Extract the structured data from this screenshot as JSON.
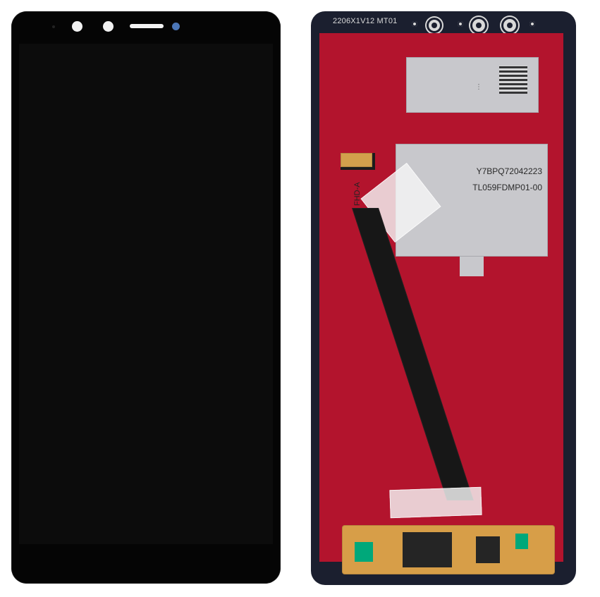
{
  "back": {
    "top_code": "2206X1V12 MT01",
    "sticker_code_1": "Y7BPQ72042223",
    "sticker_code_2": "TL059FDMP01-00",
    "flex_label": "FHD-A",
    "colors": {
      "front_glass": "#050505",
      "back_frame": "#1b1f2f",
      "back_panel": "#b3142d",
      "label_silver": "#c8c8cc",
      "flex_orange": "#d79e48"
    }
  }
}
